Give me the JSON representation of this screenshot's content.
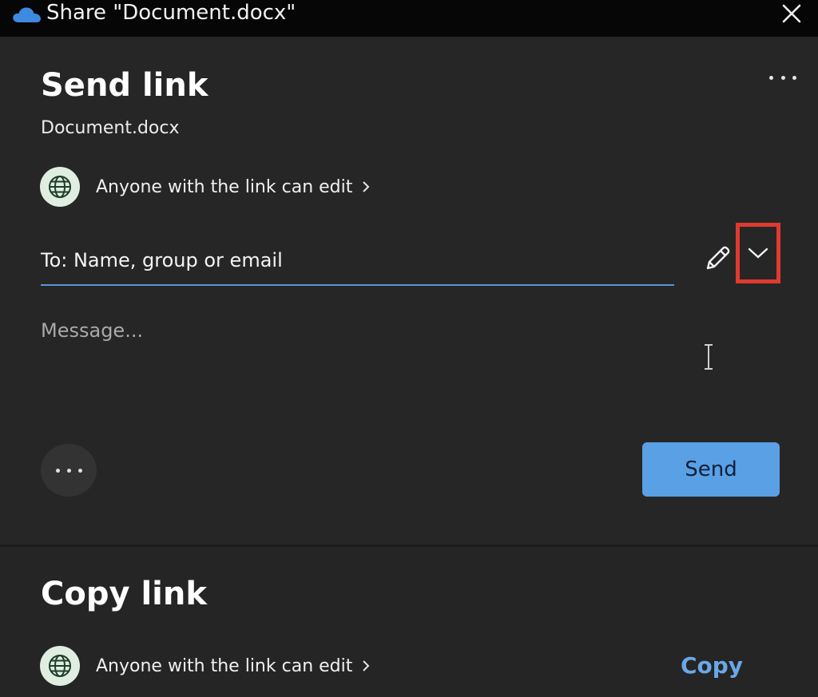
{
  "window": {
    "title": "Share \"Document.docx\"",
    "app_icon": "onedrive-cloud-icon",
    "close_icon": "close-icon"
  },
  "send_link": {
    "heading": "Send link",
    "file_name": "Document.docx",
    "permission": {
      "icon": "globe-icon",
      "label": "Anyone with the link can edit",
      "chevron": "chevron-right-icon"
    },
    "to_field": {
      "placeholder": "To: Name, group or email",
      "value": ""
    },
    "edit_icon": "pencil-icon",
    "dropdown_icon": "chevron-down-icon",
    "message": {
      "placeholder": "Message...",
      "value": ""
    },
    "send_button": "Send"
  },
  "copy_link": {
    "heading": "Copy link",
    "permission": {
      "icon": "globe-icon",
      "label": "Anyone with the link can edit",
      "chevron": "chevron-right-icon"
    },
    "copy_button": "Copy"
  },
  "colors": {
    "background": "#262626",
    "titlebar": "#060606",
    "accent": "#5aa0e4",
    "link": "#6aa8e6",
    "highlight_box": "#e03a2f",
    "globe_badge": "#dfeee1"
  }
}
